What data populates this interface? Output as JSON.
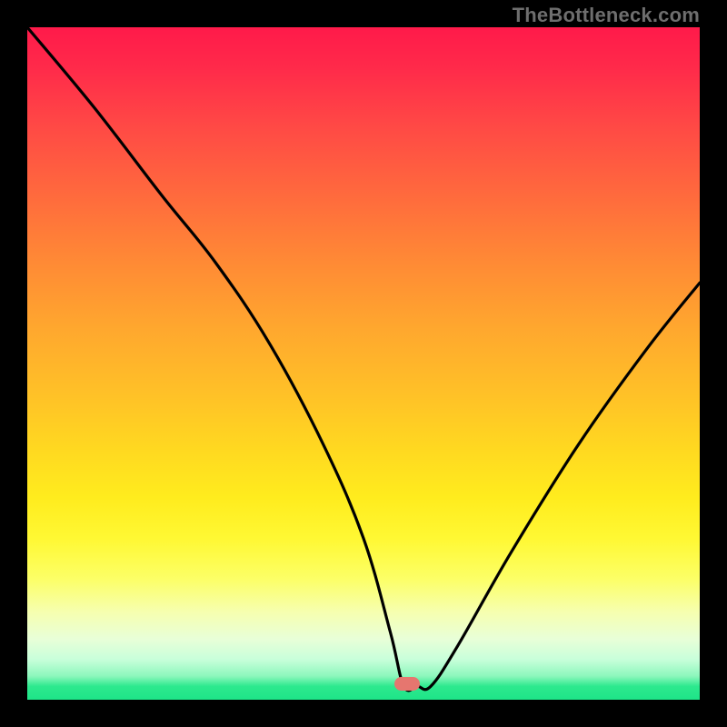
{
  "watermark": "TheBottleneck.com",
  "marker": {
    "left_pct": 56.5,
    "top_pct": 97.5
  },
  "chart_data": {
    "type": "line",
    "title": "",
    "xlabel": "",
    "ylabel": "",
    "xlim": [
      0,
      100
    ],
    "ylim": [
      0,
      100
    ],
    "series": [
      {
        "name": "bottleneck-curve",
        "x": [
          0,
          10,
          20,
          28,
          36,
          44,
          50,
          54,
          56,
          58,
          60,
          64,
          72,
          82,
          92,
          100
        ],
        "y": [
          100,
          88,
          75,
          65,
          53,
          38,
          24,
          10,
          2,
          2,
          2,
          8,
          22,
          38,
          52,
          62
        ]
      }
    ],
    "annotations": [
      {
        "name": "minimum-point",
        "x": 58,
        "y": 2
      }
    ]
  }
}
